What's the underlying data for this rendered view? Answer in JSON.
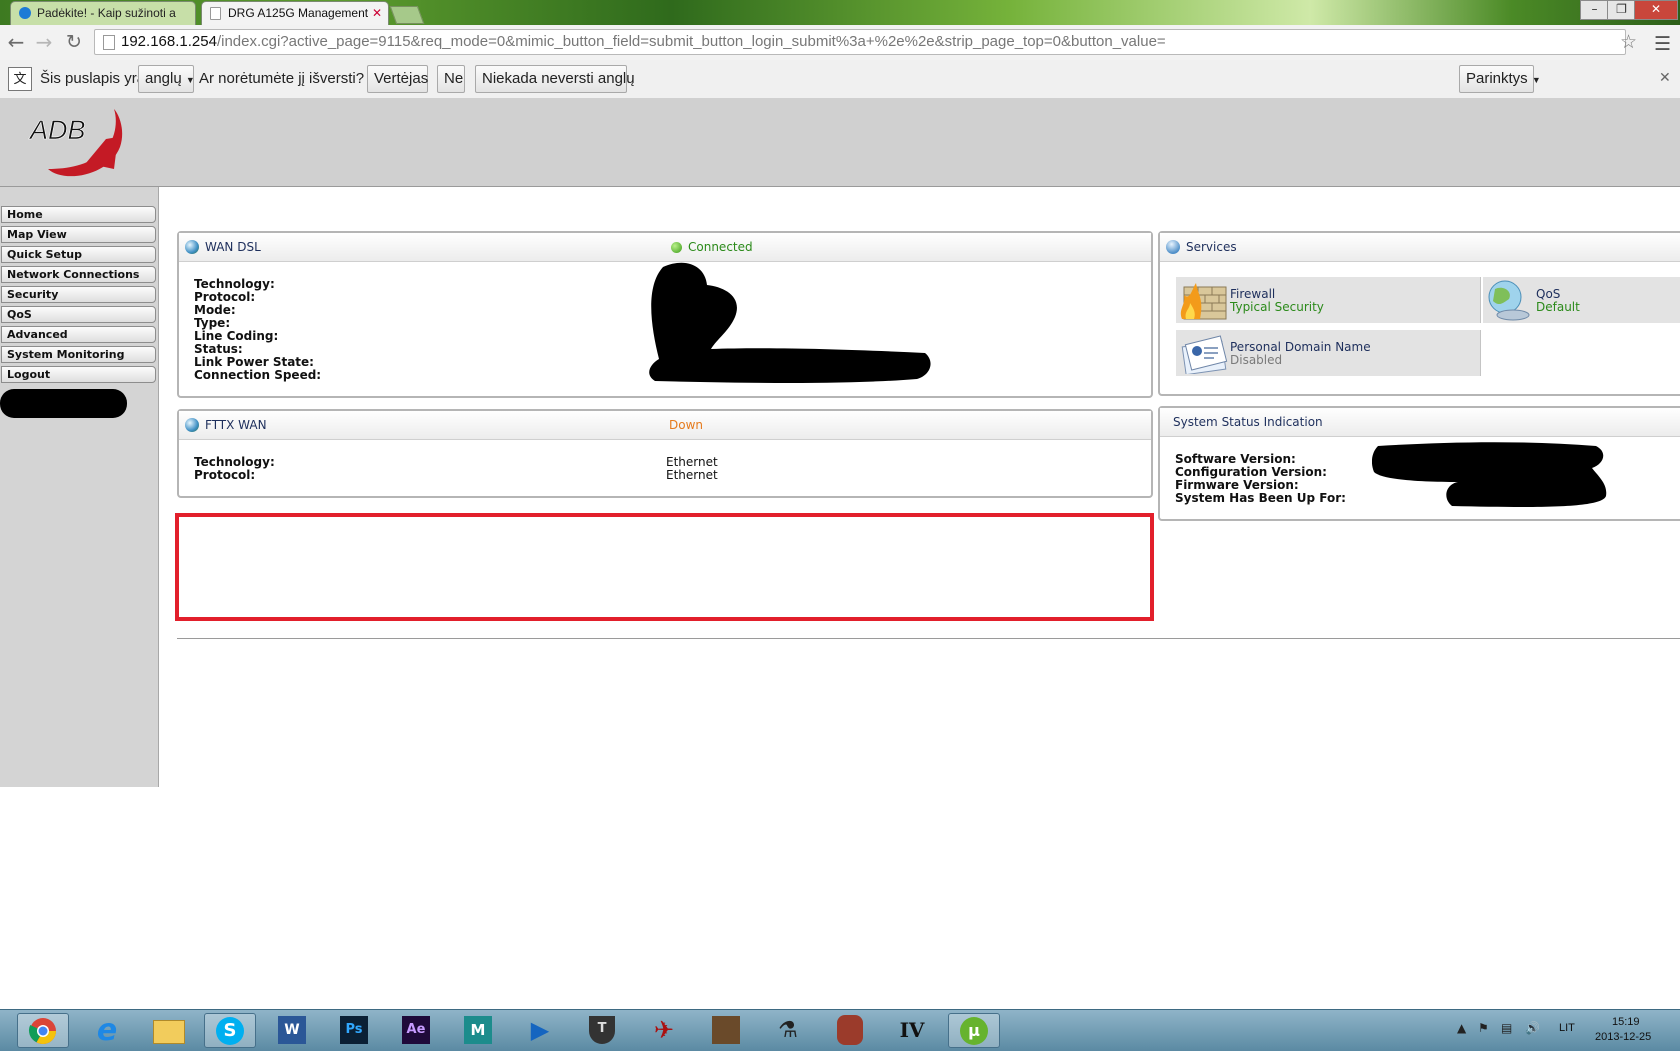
{
  "browser": {
    "tabs": [
      {
        "title": "Padėkite! - Kaip sužinoti a"
      },
      {
        "title": "DRG A125G Management"
      }
    ],
    "tab_close_glyph": "✕",
    "url_host": "192.168.1.254",
    "url_path": "/index.cgi?active_page=9115&req_mode=0&mimic_button_field=submit_button_login_submit%3a+%2e%2e&strip_page_top=0&button_value="
  },
  "translate_bar": {
    "prefix": "Šis puslapis yra",
    "language": "anglų",
    "question": "Ar norėtumėte jį išversti?",
    "translate_button": "Vertėjas",
    "no_button": "Ne",
    "never_button": "Niekada neversti anglų",
    "options_button": "Parinktys"
  },
  "sidebar": {
    "items": [
      {
        "label": "Home"
      },
      {
        "label": "Map View"
      },
      {
        "label": "Quick Setup"
      },
      {
        "label": "Network Connections"
      },
      {
        "label": "Security"
      },
      {
        "label": "QoS"
      },
      {
        "label": "Advanced"
      },
      {
        "label": "System Monitoring"
      },
      {
        "label": "Logout"
      }
    ]
  },
  "wan_dsl": {
    "title": "WAN DSL",
    "status": "Connected",
    "status_color": "#2b8a1a",
    "labels": [
      "Technology:",
      "Protocol:",
      "Mode:",
      "Type:",
      "Line Coding:",
      "Status:",
      "Link Power State:",
      "Connection Speed:"
    ]
  },
  "fttx_wan": {
    "title": "FTTX WAN",
    "status": "Down",
    "status_color": "#e57a1c",
    "labels": [
      "Technology:",
      "Protocol:"
    ],
    "values": [
      "Ethernet",
      "Ethernet"
    ]
  },
  "services": {
    "title": "Services",
    "items": [
      {
        "name": "Firewall",
        "sub": "Typical Security",
        "sub_color": "#2b8a1a",
        "icon": "firewall-icon"
      },
      {
        "name": "QoS",
        "sub": "Default",
        "sub_color": "#2b8a1a",
        "icon": "qos-icon"
      },
      {
        "name": "Personal Domain Name",
        "sub": "Disabled",
        "sub_color": "#7a7a7a",
        "icon": "domain-card-icon"
      }
    ]
  },
  "system_status": {
    "title": "System Status Indication",
    "labels": [
      "Software Version:",
      "Configuration Version:",
      "Firmware Version:",
      "System Has Been Up For:"
    ]
  },
  "taskbar": {
    "apps": [
      "chrome",
      "internet-explorer",
      "file-explorer",
      "skype",
      "word",
      "photoshop",
      "after-effects",
      "maya",
      "media-player",
      "world-of-tanks",
      "game-plane",
      "game-face",
      "counter-strike",
      "game-woman",
      "gta-iv",
      "utorrent"
    ],
    "language": "LIT",
    "time": "15:19",
    "date": "2013-12-25"
  }
}
